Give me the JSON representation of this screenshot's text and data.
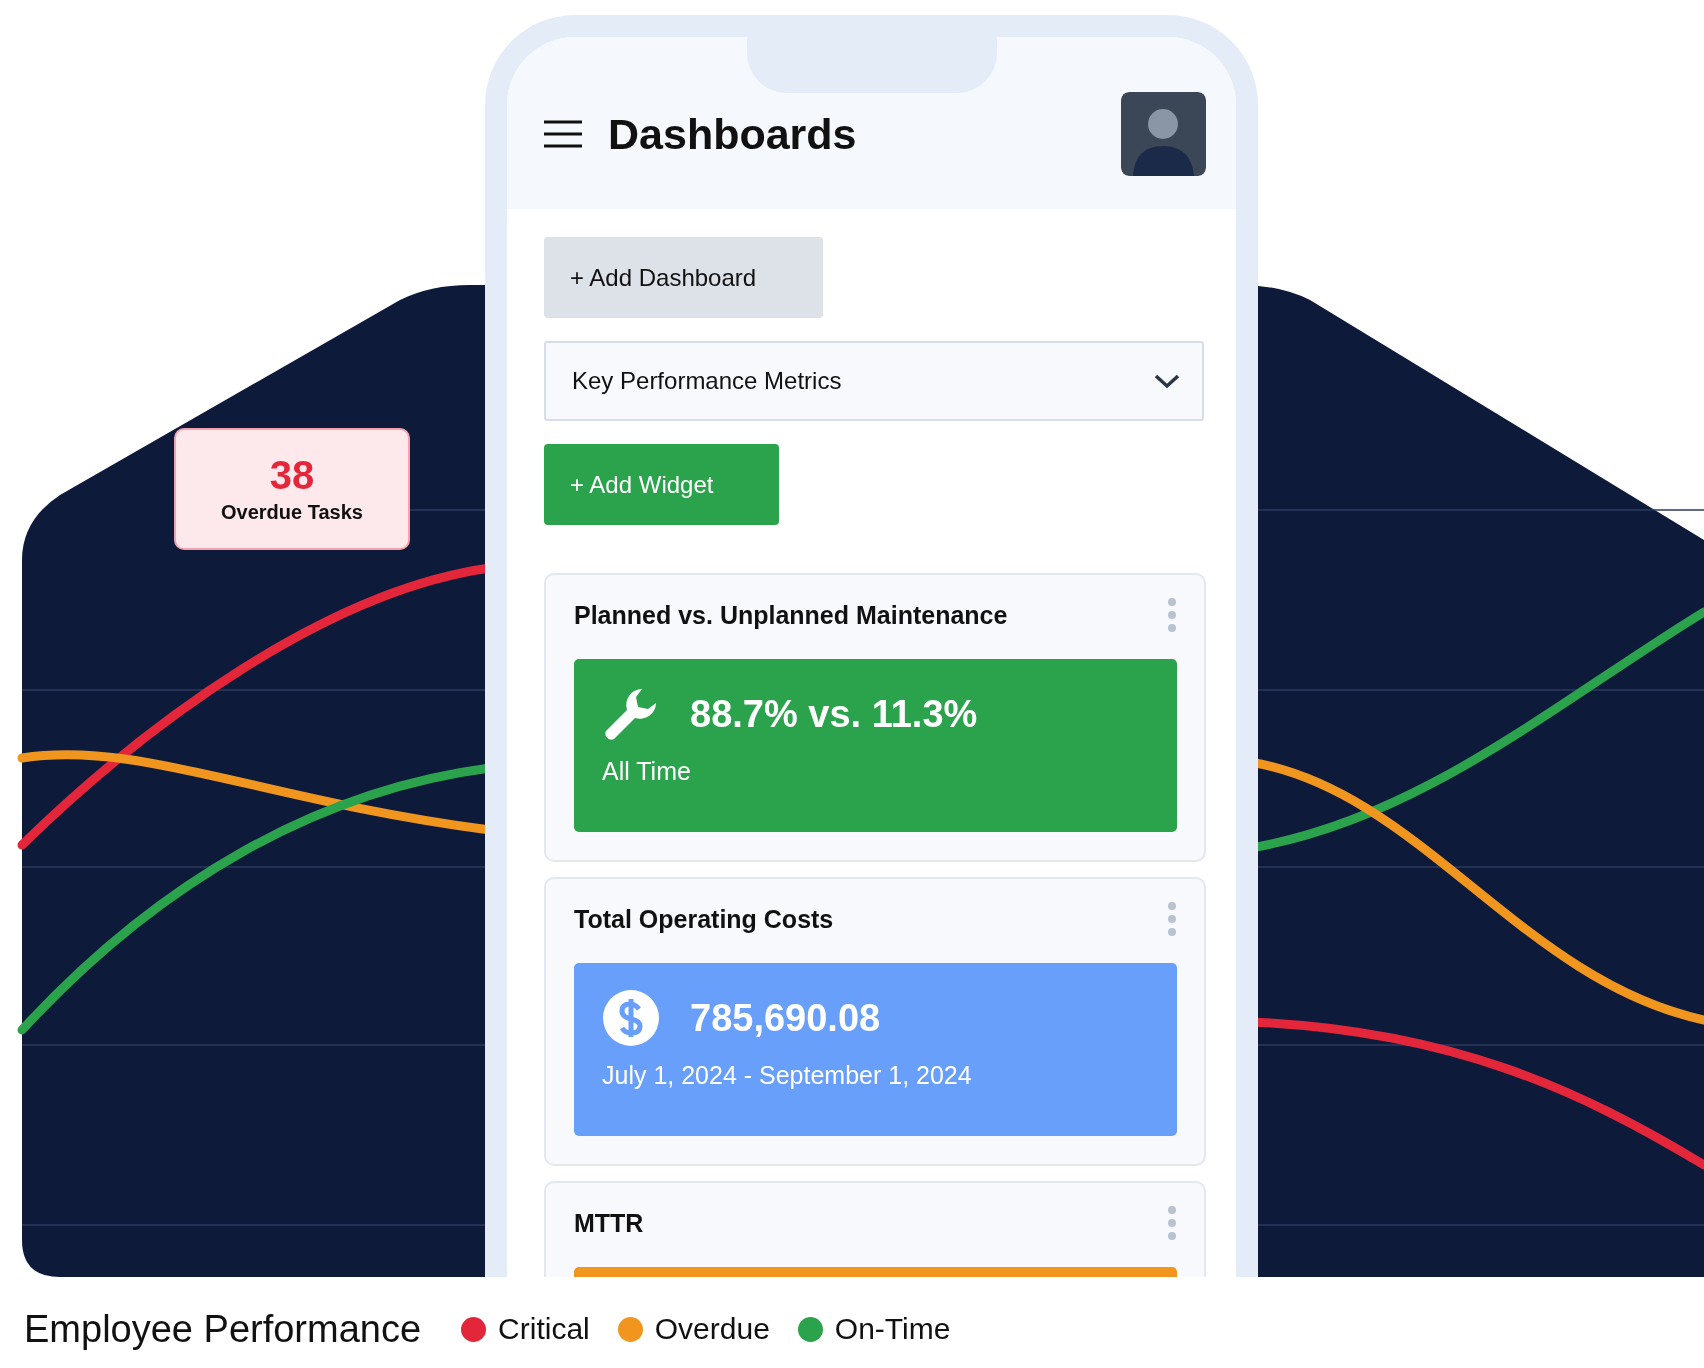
{
  "phone": {
    "title": "Dashboards",
    "add_dashboard": "+ Add Dashboard",
    "dashboard_select": {
      "value": "Key Performance Metrics"
    },
    "add_widget": "+ Add Widget",
    "widgets": [
      {
        "title": "Planned vs. Unplanned Maintenance",
        "kind": "wrench",
        "color": "#2ba24c",
        "value": "88.7% vs. 11.3%",
        "period": "All Time"
      },
      {
        "title": "Total Operating Costs",
        "kind": "dollar",
        "color": "#689ffa",
        "value": "785,690.08",
        "period": "July 1, 2024 - September 1, 2024"
      },
      {
        "title": "MTTR",
        "color": "#f0961f"
      }
    ]
  },
  "overdue_card": {
    "count": "38",
    "label": "Overdue Tasks"
  },
  "legend": {
    "title": "Employee Performance",
    "items": [
      {
        "label": "Critical",
        "color": "#e3263a"
      },
      {
        "label": "Overdue",
        "color": "#f0961f"
      },
      {
        "label": "On-Time",
        "color": "#2ba24c"
      }
    ]
  }
}
